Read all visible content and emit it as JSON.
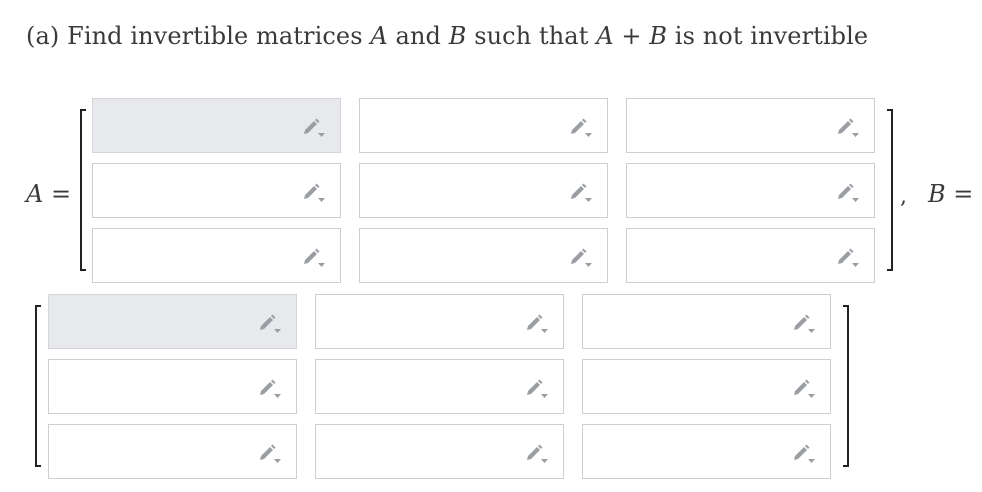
{
  "question": {
    "prefix": "(a) Find invertible matrices",
    "var_a": "A",
    "and": "and",
    "var_b": "B",
    "such_that": "such that",
    "sum_a": "A",
    "plus": "+",
    "sum_b": "B",
    "suffix": "is not invertible"
  },
  "matrix_a": {
    "label_var": "A",
    "label_eq": "=",
    "rows": [
      [
        {
          "value": "",
          "placeholder": ""
        },
        {
          "value": "",
          "placeholder": ""
        },
        {
          "value": "",
          "placeholder": ""
        }
      ],
      [
        {
          "value": "",
          "placeholder": ""
        },
        {
          "value": "",
          "placeholder": ""
        },
        {
          "value": "",
          "placeholder": ""
        }
      ],
      [
        {
          "value": "",
          "placeholder": ""
        },
        {
          "value": "",
          "placeholder": ""
        },
        {
          "value": "",
          "placeholder": ""
        }
      ]
    ]
  },
  "separator": ",",
  "matrix_b": {
    "label_var": "B",
    "label_eq": "=",
    "rows": [
      [
        {
          "value": "",
          "placeholder": ""
        },
        {
          "value": "",
          "placeholder": ""
        },
        {
          "value": "",
          "placeholder": ""
        }
      ],
      [
        {
          "value": "",
          "placeholder": ""
        },
        {
          "value": "",
          "placeholder": ""
        },
        {
          "value": "",
          "placeholder": ""
        }
      ],
      [
        {
          "value": "",
          "placeholder": ""
        },
        {
          "value": "",
          "placeholder": ""
        },
        {
          "value": "",
          "placeholder": ""
        }
      ]
    ]
  },
  "icons": {
    "cell_edit": "pencil-dropdown-icon"
  },
  "colors": {
    "active_cell_bg": "#e7e9ec",
    "cell_border": "#cfcfcf",
    "icon_gray": "#9a9ea3"
  }
}
